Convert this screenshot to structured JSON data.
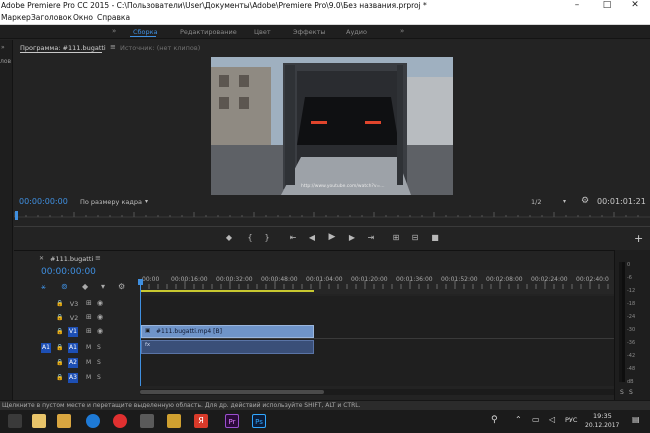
{
  "window": {
    "title": "Adobe Premiere Pro CC 2015 - C:\\Пользователи\\User\\Документы\\Adobe\\Premiere Pro\\9.0\\Без названия.prproj *",
    "btn_min": "–",
    "btn_max": "□",
    "btn_close": "✕"
  },
  "menu": {
    "items": [
      "Маркер",
      "Заголовок",
      "Окно",
      "Справка"
    ]
  },
  "workspaces": {
    "more_left": "»",
    "tabs": [
      {
        "label": "Сборка",
        "active": true
      },
      {
        "label": "Редактирование",
        "active": false
      },
      {
        "label": "Цвет",
        "active": false
      },
      {
        "label": "Эффекты",
        "active": false
      },
      {
        "label": "Аудио",
        "active": false
      }
    ],
    "more_right": "»"
  },
  "left_panel": {
    "label": "лов",
    "more": "»"
  },
  "program_monitor": {
    "tab_program": "Программа: #111.bugatti",
    "tab_source": "Источник: (нет клипов)",
    "menu_icon": "≡",
    "watermark": "http://www.youtube.com/watch?v=...",
    "timecode": "00:00:00:00",
    "fit_label": "По размеру кадра",
    "resolution": "1/2",
    "duration": "00:01:01:21",
    "add": "+"
  },
  "timeline": {
    "close": "✕",
    "name": "#111.bugatti",
    "menu": "≡",
    "timecode": "00:00:00:00",
    "ruler": [
      "00:00",
      "00:00:16:00",
      "00:00:32:00",
      "00:00:48:00",
      "00:01:04:00",
      "00:01:20:00",
      "00:01:36:00",
      "00:01:52:00",
      "00:02:08:00",
      "00:02:24:00",
      "00:02:40:0"
    ],
    "tracks": [
      {
        "name": "V3",
        "kind": "video"
      },
      {
        "name": "V2",
        "kind": "video"
      },
      {
        "name": "V1",
        "kind": "video",
        "target": true
      },
      {
        "name": "A1",
        "kind": "audio",
        "target": true
      },
      {
        "name": "A2",
        "kind": "audio"
      },
      {
        "name": "A3",
        "kind": "audio"
      }
    ],
    "video_clip": "#111.bugatti.mp4 [В]",
    "audio_clip_icon": "fx"
  },
  "meters": {
    "ticks": [
      "0",
      "-6",
      "-12",
      "-18",
      "-24",
      "-30",
      "-36",
      "-42",
      "-48",
      "dB"
    ],
    "solo_left": "S",
    "solo_right": "S"
  },
  "status": {
    "text": "Щелкните в пустом месте и перетащите выделенную область. Для др. действий используйте SHIFT, ALT и CTRL."
  },
  "taskbar": {
    "lang": "РУС",
    "time": "19:35",
    "date": "20.12.2017",
    "ai": "Ai",
    "pr": "Pr",
    "ps": "Ps",
    "yandex": "Я"
  },
  "colors": {
    "accent": "#3f8fe0",
    "track_target": "#1d4fb4",
    "video_clip": "#6f94c9",
    "audio_clip": "#3a4f78"
  }
}
